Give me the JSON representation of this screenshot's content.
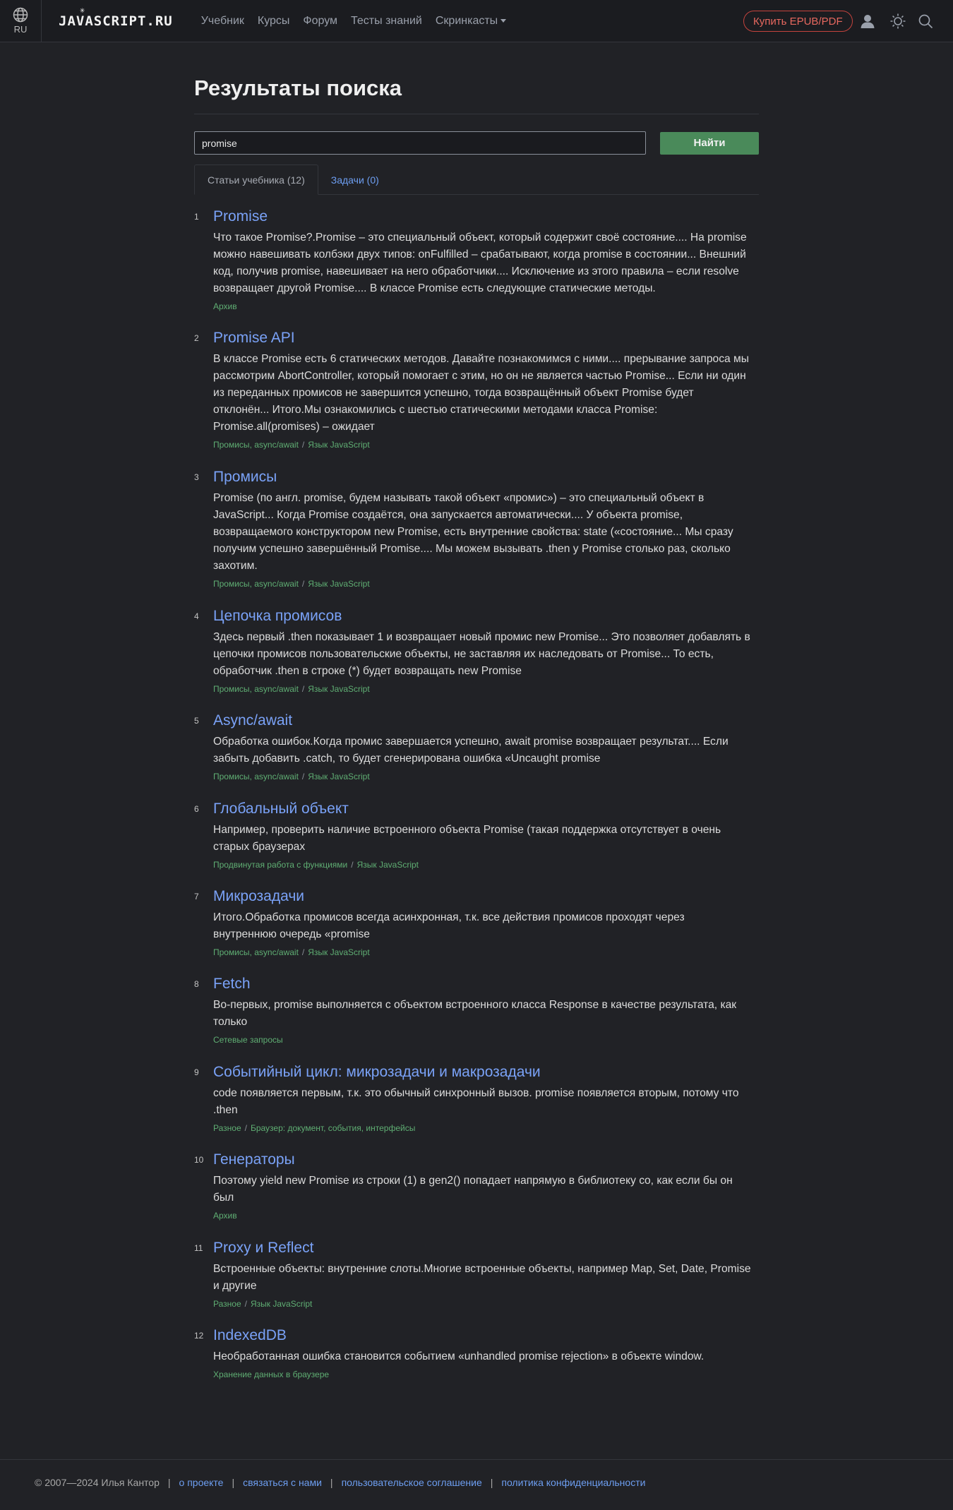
{
  "header": {
    "lang": "RU",
    "logo": "JAVASCRIPT.RU",
    "nav": [
      "Учебник",
      "Курсы",
      "Форум",
      "Тесты знаний",
      "Скринкасты"
    ],
    "buy_label": "Купить EPUB/PDF",
    "icons": [
      "globe-icon",
      "user-icon",
      "theme-icon",
      "search-icon"
    ]
  },
  "page": {
    "title": "Результаты поиска",
    "search_value": "promise",
    "search_button": "Найти",
    "tabs": [
      "Статьи учебника (12)",
      "Задачи (0)"
    ]
  },
  "results": [
    {
      "num": "1",
      "title": "Promise",
      "snippet": "Что такое Promise?.Promise – это специальный объект, который содержит своё состояние.... На promise\nможно навешивать колбэки двух типов: onFulfilled – срабатывают, когда promise в состоянии... Внешний\nкод, получив promise, навешивает на него обработчики.... Исключение из этого правила – если resolve\nвозвращает другой Promise.... В классе Promise есть следующие статические методы.",
      "crumbs": [
        "Архив"
      ]
    },
    {
      "num": "2",
      "title": "Promise API",
      "snippet": "В классе Promise есть 6 статических методов. Давайте познакомимся с ними.... прерывание запроса мы\nрассмотрим AbortController, который помогает с этим, но он не является частью Promise... Если ни один\nиз переданных промисов не завершится успешно, тогда возвращённый объект Promise будет\nотклонён... Итого.Мы ознакомились с шестью статическими методами класса Promise:\nPromise.all(promises) – ожидает",
      "crumbs": [
        "Промисы, async/await",
        "Язык JavaScript"
      ]
    },
    {
      "num": "3",
      "title": "Промисы",
      "snippet": "Promise (по англ. promise, будем называть такой объект «промис») – это специальный объект в\nJavaScript... Когда Promise создаётся, она запускается автоматически.... У объекта promise,\nвозвращаемого конструктором new Promise, есть внутренние свойства: state («состояние... Мы сразу\nполучим успешно завершённый Promise.... Мы можем вызывать .then у Promise столько раз, сколько\nзахотим.",
      "crumbs": [
        "Промисы, async/await",
        "Язык JavaScript"
      ]
    },
    {
      "num": "4",
      "title": "Цепочка промисов",
      "snippet": "Здесь первый .then показывает 1 и возвращает новый промис new Promise... Это позволяет добавлять в\nцепочки промисов пользовательские объекты, не заставляя их наследовать от Promise... То есть,\nобработчик .then в строке (*) будет возвращать new Promise",
      "crumbs": [
        "Промисы, async/await",
        "Язык JavaScript"
      ]
    },
    {
      "num": "5",
      "title": "Async/await",
      "snippet": "Обработка ошибок.Когда промис завершается успешно, await promise возвращает результат.... Если\nзабыть добавить .catch, то будет сгенерирована ошибка «Uncaught promise",
      "crumbs": [
        "Промисы, async/await",
        "Язык JavaScript"
      ]
    },
    {
      "num": "6",
      "title": "Глобальный объект",
      "snippet": "Например, проверить наличие встроенного объекта Promise (такая поддержка отсутствует в очень\nстарых браузерах",
      "crumbs": [
        "Продвинутая работа с функциями",
        "Язык JavaScript"
      ]
    },
    {
      "num": "7",
      "title": "Микрозадачи",
      "snippet": "Итого.Обработка промисов всегда асинхронная, т.к. все действия промисов проходят через\nвнутреннюю очередь «promise",
      "crumbs": [
        "Промисы, async/await",
        "Язык JavaScript"
      ]
    },
    {
      "num": "8",
      "title": "Fetch",
      "snippet": "Во-первых, promise выполняется с объектом встроенного класса Response в качестве результата, как\nтолько",
      "crumbs": [
        "Сетевые запросы"
      ]
    },
    {
      "num": "9",
      "title": "Событийный цикл: микрозадачи и макрозадачи",
      "snippet": "code появляется первым, т.к. это обычный синхронный вызов. promise появляется вторым, потому что\n.then",
      "crumbs": [
        "Разное",
        "Браузер: документ, события, интерфейсы"
      ]
    },
    {
      "num": "10",
      "title": "Генераторы",
      "snippet": "Поэтому yield new Promise из строки (1) в gen2() попадает напрямую в библиотеку co, как если бы он\nбыл",
      "crumbs": [
        "Архив"
      ]
    },
    {
      "num": "11",
      "title": "Proxy и Reflect",
      "snippet": "Встроенные объекты: внутренние слоты.Многие встроенные объекты, например Map, Set, Date, Promise\nи другие",
      "crumbs": [
        "Разное",
        "Язык JavaScript"
      ]
    },
    {
      "num": "12",
      "title": "IndexedDB",
      "snippet": "Необработанная ошибка становится событием «unhandled promise rejection» в объекте window.",
      "crumbs": [
        "Хранение данных в браузере"
      ]
    }
  ],
  "footer": {
    "copyright": "© 2007—2024  Илья Кантор",
    "links": [
      "о проекте",
      "связаться с нами",
      "пользовательское соглашение",
      "политика конфиденциальности"
    ]
  }
}
